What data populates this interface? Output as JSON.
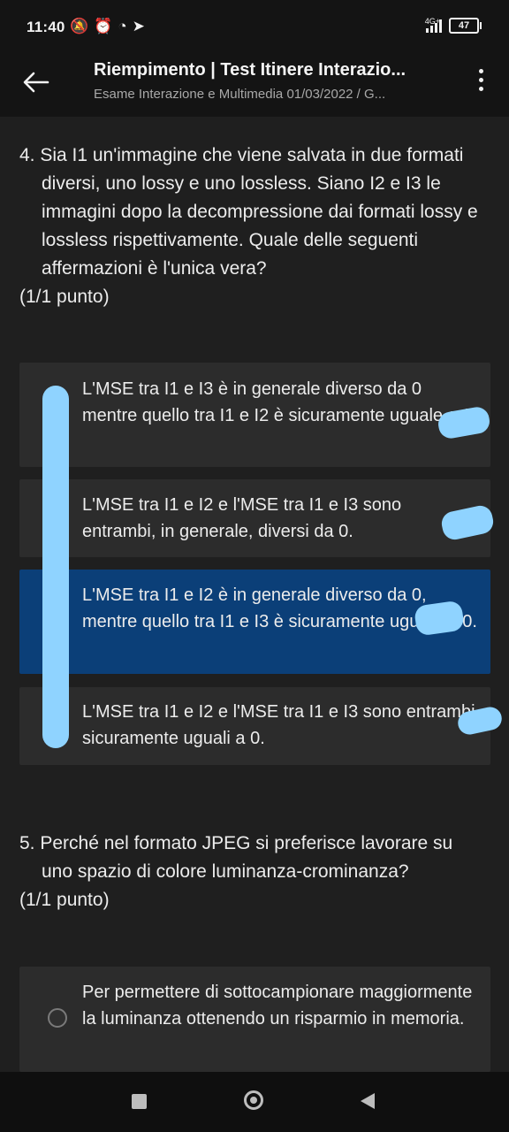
{
  "status": {
    "time": "11:40",
    "network": "4G+",
    "battery": "47"
  },
  "header": {
    "title": "Riempimento | Test Itinere Interazio...",
    "subtitle": "Esame Interazione e Multimedia 01/03/2022 / G..."
  },
  "questions": [
    {
      "text": "4. Sia I1 un'immagine che viene salvata in due formati diversi, uno lossy e uno lossless. Siano I2 e I3 le immagini dopo la decompressione dai formati lossy e lossless rispettivamente. Quale delle seguenti affermazioni è l'unica vera?",
      "points": "(1/1 punto)",
      "options": [
        {
          "label": "L'MSE tra I1 e I3 è in generale diverso da 0 mentre quello tra I1 e I2 è sicuramente uguale a 0.",
          "selected": false
        },
        {
          "label": "L'MSE tra I1 e I2 e l'MSE tra I1 e I3 sono entrambi, in generale, diversi da 0.",
          "selected": false
        },
        {
          "label": "L'MSE tra I1 e I2 è in generale diverso da 0, mentre quello tra I1 e I3 è sicuramente uguale a 0.",
          "selected": true
        },
        {
          "label": "L'MSE tra I1 e I2 e l'MSE tra I1 e I3 sono entrambi sicuramente uguali a 0.",
          "selected": false
        }
      ]
    },
    {
      "text": "5. Perché nel formato JPEG si preferisce lavorare su uno spazio di colore luminanza-crominanza?",
      "points": "(1/1 punto)",
      "options": [
        {
          "label": "Per permettere di sottocampionare maggiormente la luminanza ottenendo un risparmio in memoria.",
          "selected": false
        }
      ]
    }
  ],
  "colors": {
    "background": "#1f1f1f",
    "option_background": "#2c2c2c",
    "selected_option": "#0b3f78",
    "highlight": "#8fd3ff"
  },
  "icons": {
    "back": "arrow-left-icon",
    "more": "more-vertical-icon",
    "nav_recents": "square-icon",
    "nav_home": "circle-icon",
    "nav_back": "triangle-back-icon"
  }
}
